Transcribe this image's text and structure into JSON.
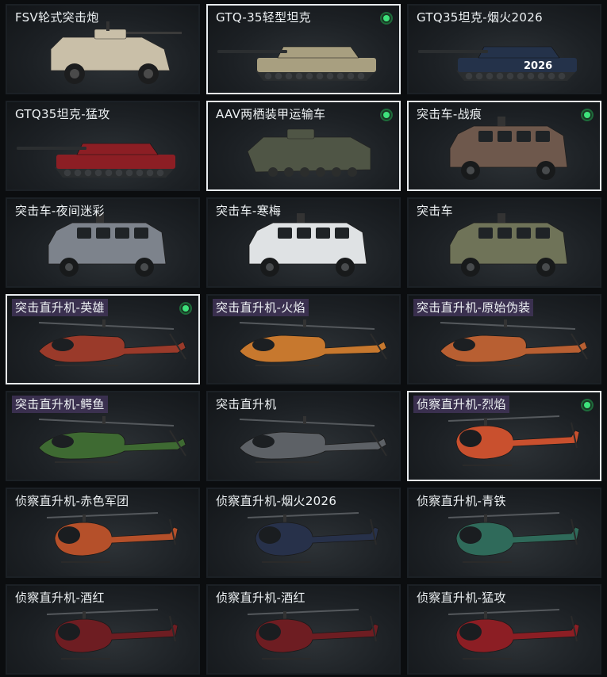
{
  "items": [
    {
      "label": "FSV轮式突击炮",
      "icon": "armored-car-icon",
      "color": "#c9bfa8",
      "selected": false,
      "equipped": false,
      "hl": false
    },
    {
      "label": "GTQ-35轻型坦克",
      "icon": "tank-icon",
      "color": "#a89f80",
      "selected": true,
      "equipped": true,
      "hl": false
    },
    {
      "label": "GTQ35坦克-烟火2026",
      "icon": "tank-icon",
      "color": "#24324a",
      "selected": false,
      "equipped": false,
      "hl": false,
      "badge": "2026"
    },
    {
      "label": "GTQ35坦克-猛攻",
      "icon": "tank-icon",
      "color": "#8c1e24",
      "selected": false,
      "equipped": false,
      "hl": false
    },
    {
      "label": "AAV两栖装甲运输车",
      "icon": "amphibious-vehicle-icon",
      "color": "#4f5545",
      "selected": true,
      "equipped": true,
      "hl": false
    },
    {
      "label": "突击车-战痕",
      "icon": "assault-vehicle-icon",
      "color": "#6e584c",
      "selected": true,
      "equipped": true,
      "hl": false
    },
    {
      "label": "突击车-夜间迷彩",
      "icon": "assault-vehicle-icon",
      "color": "#7d838c",
      "selected": false,
      "equipped": false,
      "hl": false
    },
    {
      "label": "突击车-寒梅",
      "icon": "assault-vehicle-icon",
      "color": "#dfe2e4",
      "selected": false,
      "equipped": false,
      "hl": false
    },
    {
      "label": "突击车",
      "icon": "assault-vehicle-icon",
      "color": "#6f7358",
      "selected": false,
      "equipped": false,
      "hl": false
    },
    {
      "label": "突击直升机-英雄",
      "icon": "attack-helicopter-icon",
      "color": "#9a3a2a",
      "selected": true,
      "equipped": true,
      "hl": true
    },
    {
      "label": "突击直升机-火焰",
      "icon": "attack-helicopter-icon",
      "color": "#c7782e",
      "selected": false,
      "equipped": false,
      "hl": true
    },
    {
      "label": "突击直升机-原始伪装",
      "icon": "attack-helicopter-icon",
      "color": "#b85f32",
      "selected": false,
      "equipped": false,
      "hl": true
    },
    {
      "label": "突击直升机-鳄鱼",
      "icon": "attack-helicopter-icon",
      "color": "#3e6a32",
      "selected": false,
      "equipped": false,
      "hl": true
    },
    {
      "label": "突击直升机",
      "icon": "attack-helicopter-icon",
      "color": "#5d6166",
      "selected": false,
      "equipped": false,
      "hl": false
    },
    {
      "label": "侦察直升机-烈焰",
      "icon": "scout-helicopter-icon",
      "color": "#c9502e",
      "selected": true,
      "equipped": true,
      "hl": true
    },
    {
      "label": "侦察直升机-赤色军团",
      "icon": "scout-helicopter-icon",
      "color": "#b5502a",
      "selected": false,
      "equipped": false,
      "hl": false
    },
    {
      "label": "侦察直升机-烟火2026",
      "icon": "scout-helicopter-icon",
      "color": "#27314a",
      "selected": false,
      "equipped": false,
      "hl": false
    },
    {
      "label": "侦察直升机-青铁",
      "icon": "scout-helicopter-icon",
      "color": "#2f6a5a",
      "selected": false,
      "equipped": false,
      "hl": false
    },
    {
      "label": "侦察直升机-酒红",
      "icon": "scout-helicopter-icon",
      "color": "#6e1d22",
      "selected": false,
      "equipped": false,
      "hl": false
    },
    {
      "label": "侦察直升机-酒红",
      "icon": "scout-helicopter-icon",
      "color": "#6e1d22",
      "selected": false,
      "equipped": false,
      "hl": false
    },
    {
      "label": "侦察直升机-猛攻",
      "icon": "scout-helicopter-icon",
      "color": "#8c1e24",
      "selected": false,
      "equipped": false,
      "hl": false
    }
  ]
}
